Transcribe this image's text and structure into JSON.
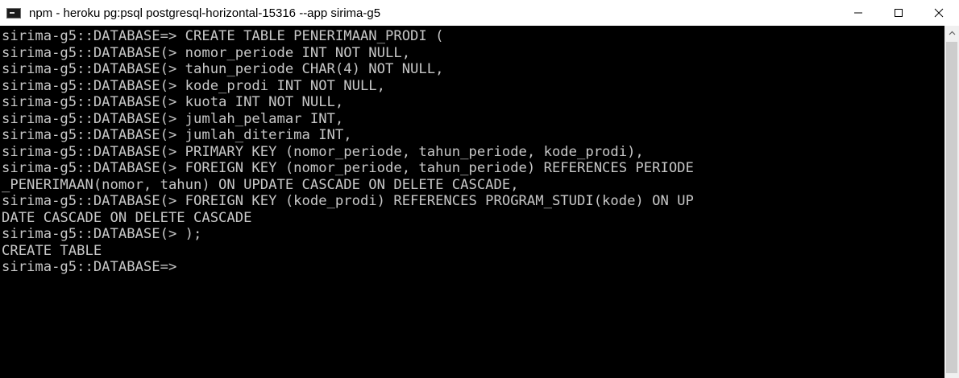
{
  "window": {
    "title": "npm - heroku  pg:psql postgresql-horizontal-15316 --app sirima-g5",
    "icon": "console-app-icon"
  },
  "controls": {
    "minimize": "minimize-icon",
    "maximize": "maximize-icon",
    "close": "close-icon"
  },
  "console": {
    "lines": [
      "sirima-g5::DATABASE=> CREATE TABLE PENERIMAAN_PRODI (",
      "sirima-g5::DATABASE(> nomor_periode INT NOT NULL,",
      "sirima-g5::DATABASE(> tahun_periode CHAR(4) NOT NULL,",
      "sirima-g5::DATABASE(> kode_prodi INT NOT NULL,",
      "sirima-g5::DATABASE(> kuota INT NOT NULL,",
      "sirima-g5::DATABASE(> jumlah_pelamar INT,",
      "sirima-g5::DATABASE(> jumlah_diterima INT,",
      "sirima-g5::DATABASE(> PRIMARY KEY (nomor_periode, tahun_periode, kode_prodi),",
      "sirima-g5::DATABASE(> FOREIGN KEY (nomor_periode, tahun_periode) REFERENCES PERIODE",
      "_PENERIMAAN(nomor, tahun) ON UPDATE CASCADE ON DELETE CASCADE,",
      "sirima-g5::DATABASE(> FOREIGN KEY (kode_prodi) REFERENCES PROGRAM_STUDI(kode) ON UP",
      "DATE CASCADE ON DELETE CASCADE",
      "sirima-g5::DATABASE(> );",
      "CREATE TABLE",
      "sirima-g5::DATABASE=>"
    ],
    "text_color": "#c7c7c7",
    "background": "#000000"
  }
}
